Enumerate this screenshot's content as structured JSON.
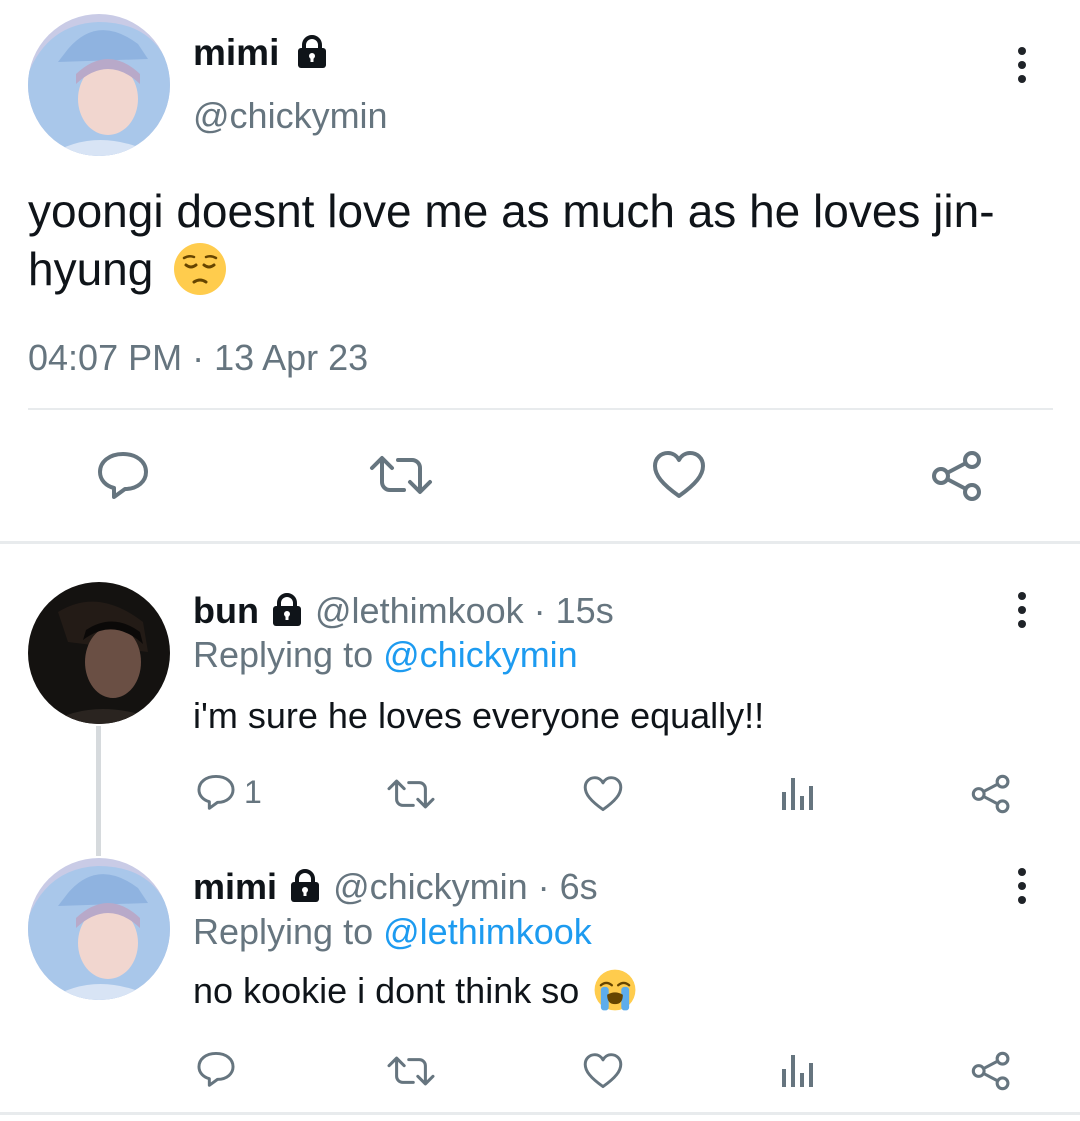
{
  "main_tweet": {
    "display_name": "mimi",
    "handle": "@chickymin",
    "text": "yoongi doesnt love me as much as he loves jin-hyung",
    "timestamp": "04:07 PM · 13 Apr 23",
    "actions": [
      "reply-icon",
      "retweet-icon",
      "like-icon",
      "share-icon"
    ]
  },
  "reply1": {
    "display_name": "bun",
    "handle": "@lethimkook",
    "time": "· 15s",
    "replying_prefix": "Replying to",
    "replying_to": "@chickymin",
    "text": "i'm sure he loves everyone equally!!",
    "reply_count": "1"
  },
  "reply2": {
    "display_name": "mimi",
    "handle": "@chickymin",
    "time": "· 6s",
    "replying_prefix": "Replying to",
    "replying_to": "@lethimkook",
    "text": "no kookie i dont think so"
  },
  "colors": {
    "text": "#0f1419",
    "muted": "#66757f",
    "link": "#1d9bf0",
    "divider": "#e8ebed"
  }
}
